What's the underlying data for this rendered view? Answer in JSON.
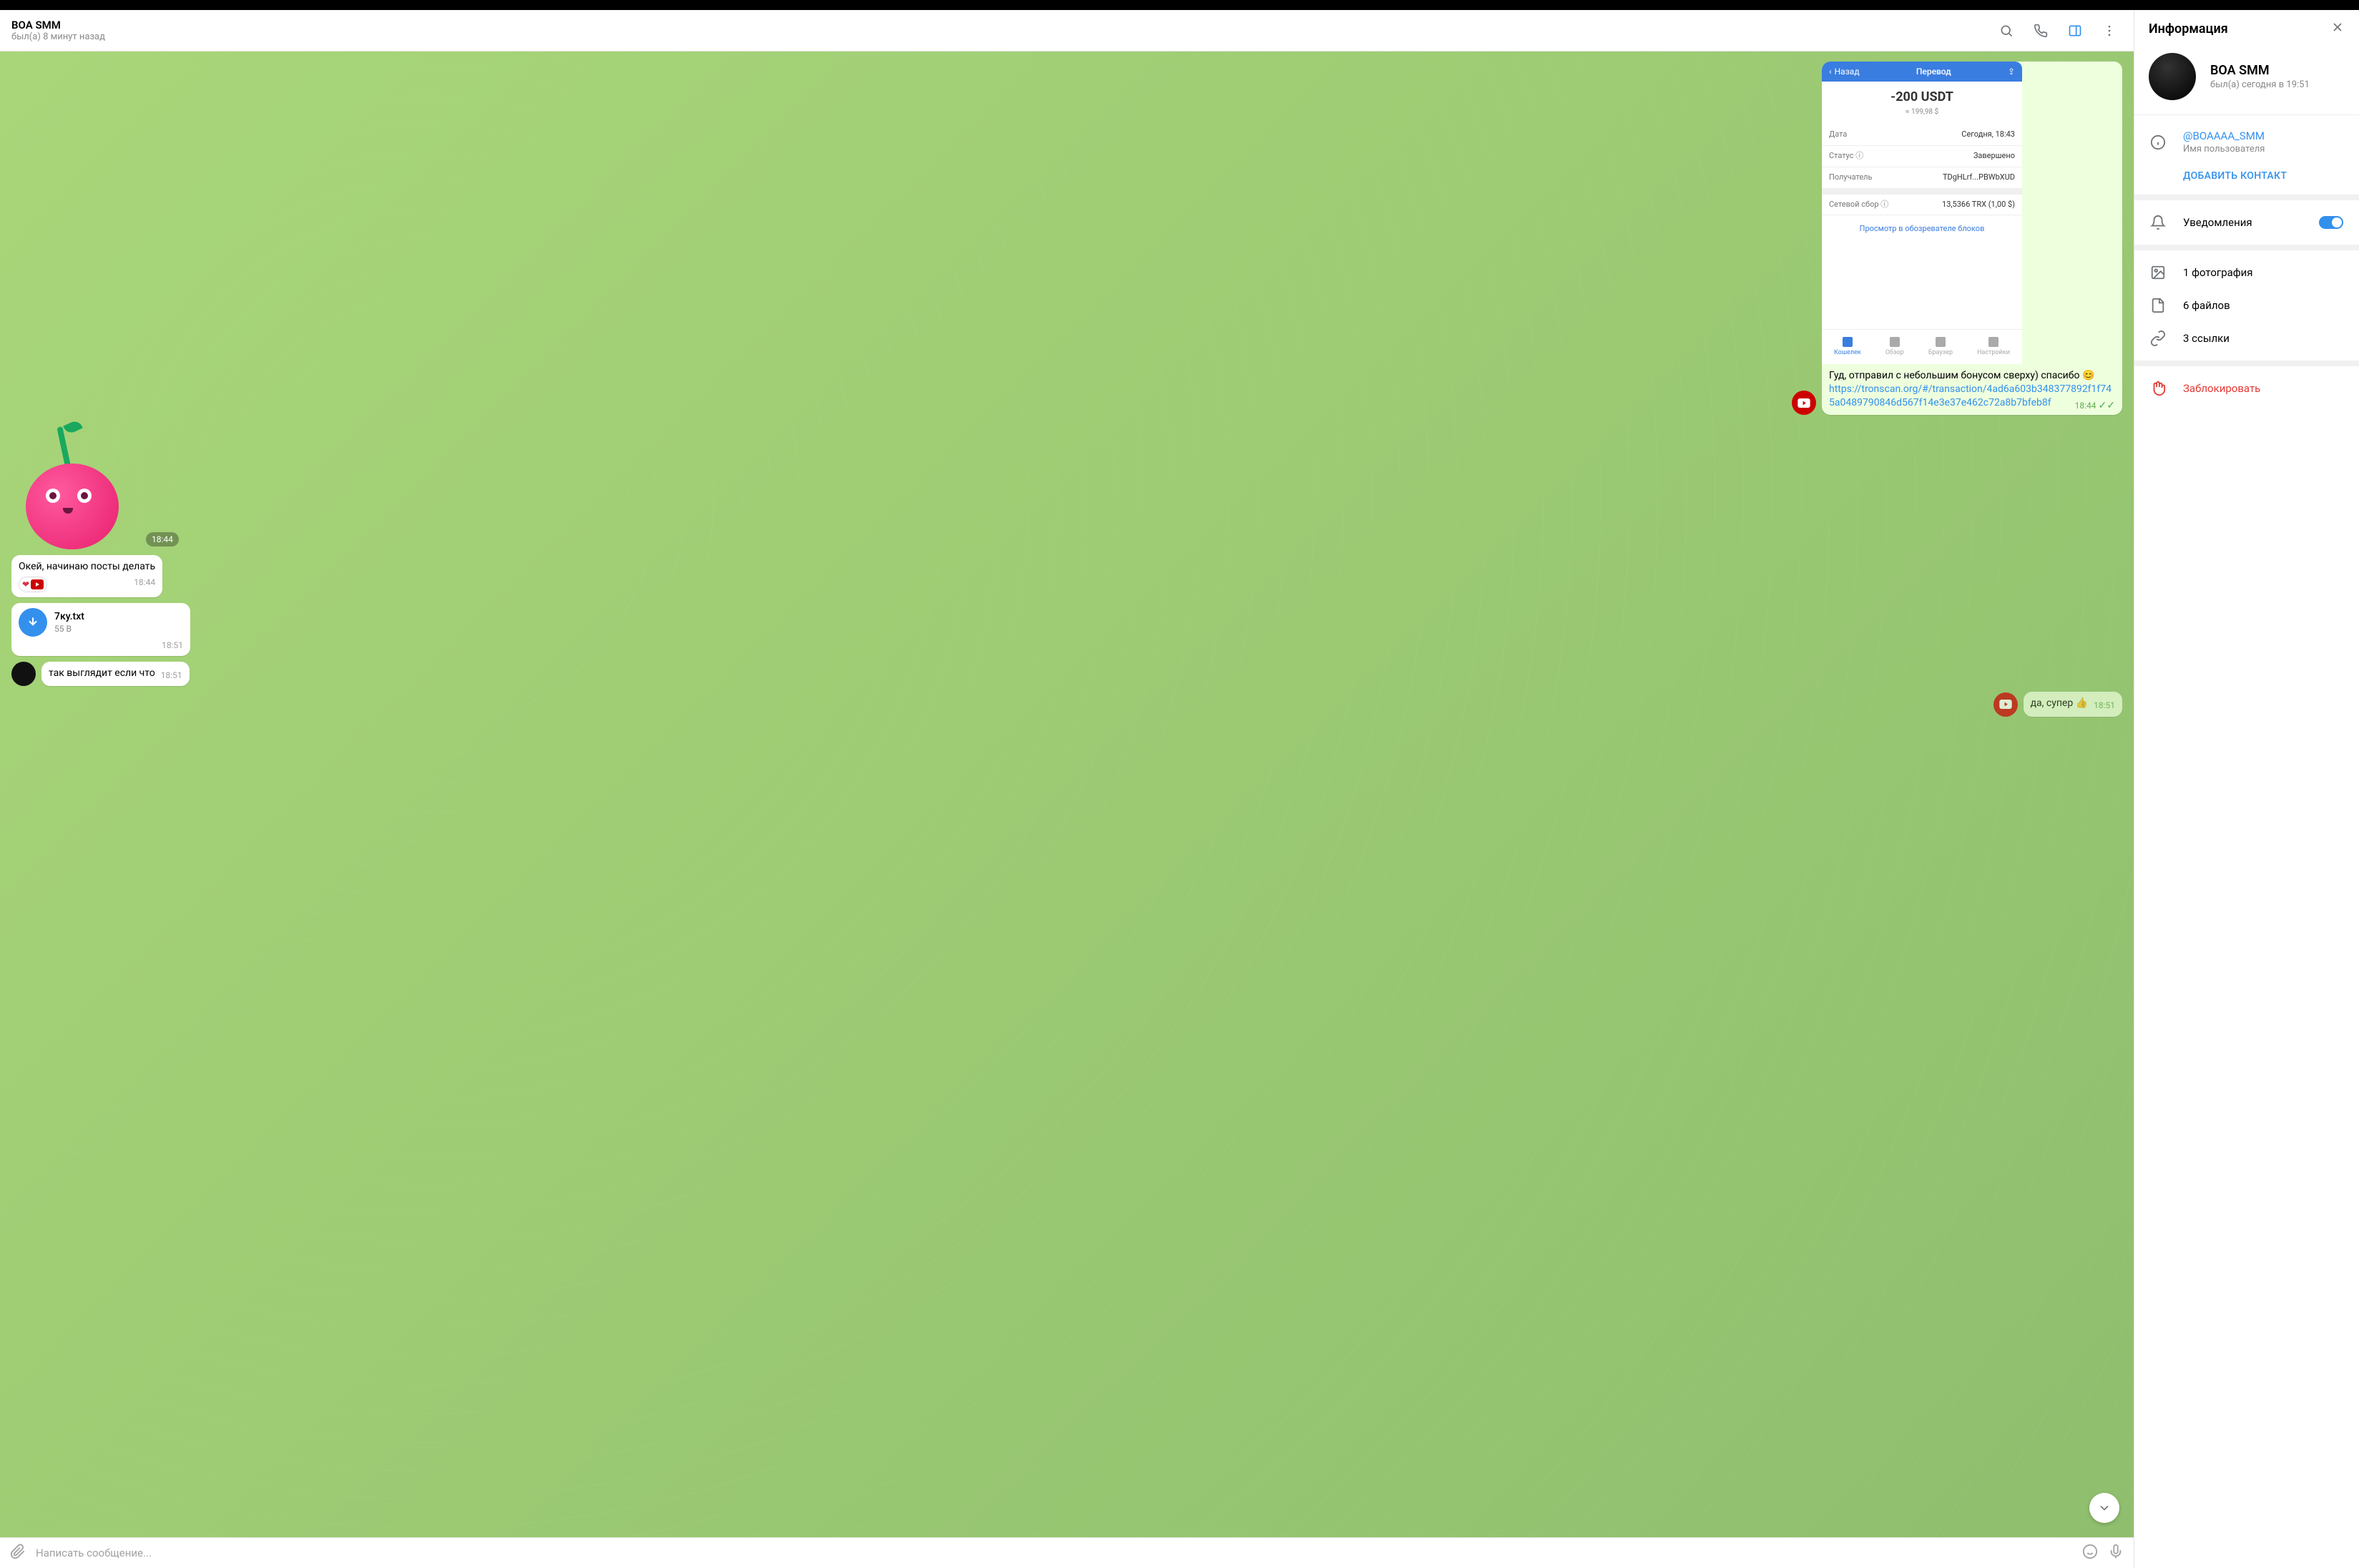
{
  "header": {
    "name": "BOA SMM",
    "status": "был(а) 8 минут назад"
  },
  "tx": {
    "nav_back": "Назад",
    "nav_title": "Перевод",
    "amount": "-200 USDT",
    "sub": "≈ 199,98 $",
    "rows": [
      {
        "k": "Дата",
        "v": "Сегодня, 18:43"
      },
      {
        "k": "Статус ⓘ",
        "v": "Завершено"
      },
      {
        "k": "Получатель",
        "v": "TDgHLrf...PBWbXUD"
      }
    ],
    "fee_k": "Сетевой сбор ⓘ",
    "fee_v": "13,5366 TRX (1,00 $)",
    "explorer": "Просмотр в обозревателе блоков",
    "tabs": [
      "Кошелек",
      "Обзор",
      "Браузер",
      "Настройки"
    ]
  },
  "msg1": {
    "text": "Гуд, отправил с небольшим бонусом сверху) спасибо 😊",
    "link": "https://tronscan.org/#/transaction/4ad6a603b348377892f1f745a0489790846d567f14e3e37e462c72a8b7bfeb8f",
    "time": "18:44"
  },
  "sticker_time": "18:44",
  "msg2": {
    "text": "Окей, начинаю посты делать",
    "time": "18:44"
  },
  "file": {
    "name": "7ку.txt",
    "size": "55 B",
    "time": "18:51"
  },
  "msg3": {
    "text": "так выглядит если что",
    "time": "18:51"
  },
  "msg4": {
    "text": "да, супер 👍",
    "time": "18:51"
  },
  "composer": {
    "placeholder": "Написать сообщение..."
  },
  "info": {
    "title": "Информация",
    "name": "BOA SMM",
    "status": "был(а) сегодня в 19:51",
    "username": "@BOAAAA_SMM",
    "username_label": "Имя пользователя",
    "add_contact": "ДОБАВИТЬ КОНТАКТ",
    "notifications": "Уведомления",
    "photos": "1 фотография",
    "files": "6 файлов",
    "links": "3 ссылки",
    "block": "Заблокировать"
  }
}
